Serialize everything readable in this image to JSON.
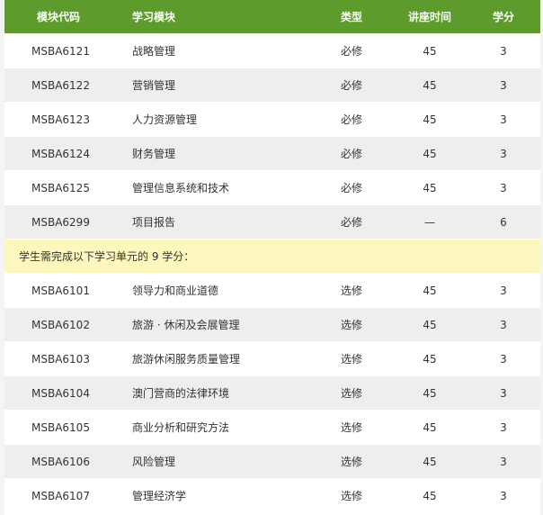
{
  "header": {
    "code": "模块代码",
    "name": "学习模块",
    "type": "类型",
    "hours": "讲座时间",
    "credits": "学分"
  },
  "core_rows": [
    {
      "code": "MSBA6121",
      "name": "战略管理",
      "type": "必修",
      "hours": "45",
      "credits": "3"
    },
    {
      "code": "MSBA6122",
      "name": "营销管理",
      "type": "必修",
      "hours": "45",
      "credits": "3"
    },
    {
      "code": "MSBA6123",
      "name": "人力资源管理",
      "type": "必修",
      "hours": "45",
      "credits": "3"
    },
    {
      "code": "MSBA6124",
      "name": "财务管理",
      "type": "必修",
      "hours": "45",
      "credits": "3"
    },
    {
      "code": "MSBA6125",
      "name": "管理信息系统和技术",
      "type": "必修",
      "hours": "45",
      "credits": "3"
    },
    {
      "code": "MSBA6299",
      "name": "项目报告",
      "type": "必修",
      "hours": "—",
      "credits": "6"
    }
  ],
  "note": "学生需完成以下学习单元的 9 学分：",
  "elective_rows": [
    {
      "code": "MSBA6101",
      "name": "领导力和商业道德",
      "type": "选修",
      "hours": "45",
      "credits": "3"
    },
    {
      "code": "MSBA6102",
      "name": "旅游 · 休闲及会展管理",
      "type": "选修",
      "hours": "45",
      "credits": "3"
    },
    {
      "code": "MSBA6103",
      "name": "旅游休闲服务质量管理",
      "type": "选修",
      "hours": "45",
      "credits": "3"
    },
    {
      "code": "MSBA6104",
      "name": "澳门营商的法律环境",
      "type": "选修",
      "hours": "45",
      "credits": "3"
    },
    {
      "code": "MSBA6105",
      "name": "商业分析和研究方法",
      "type": "选修",
      "hours": "45",
      "credits": "3"
    },
    {
      "code": "MSBA6106",
      "name": "风险管理",
      "type": "选修",
      "hours": "45",
      "credits": "3"
    },
    {
      "code": "MSBA6107",
      "name": "管理经济学",
      "type": "选修",
      "hours": "45",
      "credits": "3"
    }
  ],
  "colors": {
    "header_bg": "#5d9b2c",
    "note_bg": "#fdf6bd",
    "row_alt_bg": "#eeeeee"
  }
}
